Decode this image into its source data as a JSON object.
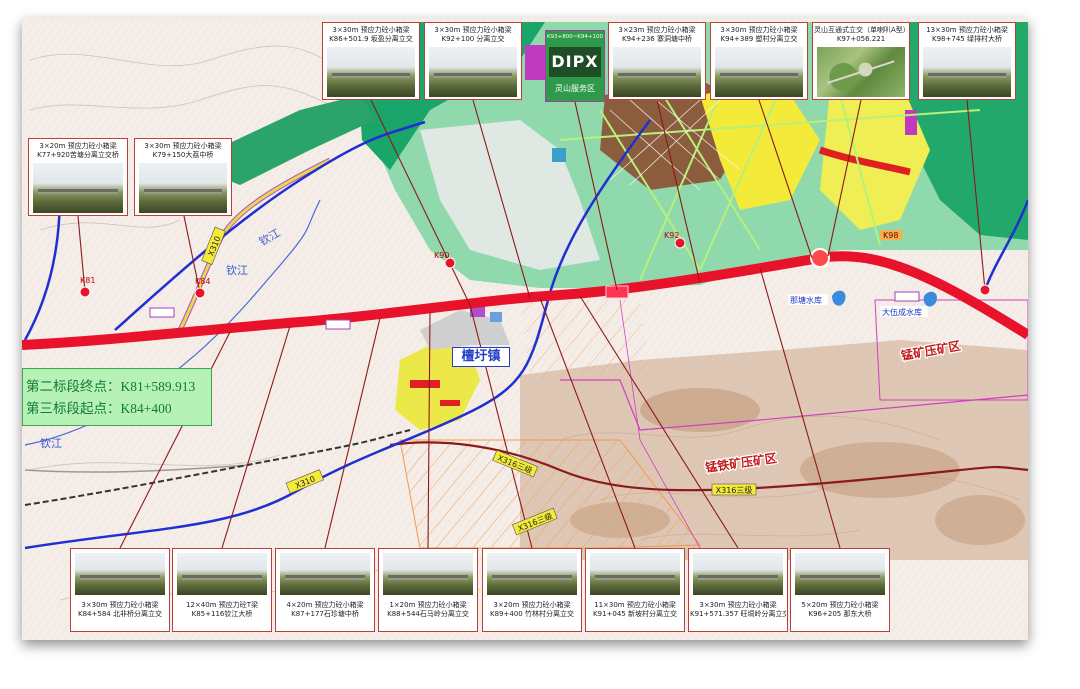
{
  "section_box": {
    "end_label": "第二标段终点：K81+589.913",
    "start_label": "第三标段起点：K84+400"
  },
  "service_area": {
    "chainage": "K93+800~K94+100",
    "icons": "DIPX",
    "name": "灵山服务区"
  },
  "callouts_top": [
    {
      "line1": "3×30m 预应力砼小箱梁",
      "line2": "K86+501.9 坂盈分离立交"
    },
    {
      "line1": "3×30m 预应力砼小箱梁",
      "line2": "K92+100 分离立交"
    },
    {
      "line1": "3×23m 预应力砼小箱梁",
      "line2": "K94+236 寨洞塘中桥"
    },
    {
      "line1": "3×30m 预应力砼小箱梁",
      "line2": "K94+389 塑村分离立交"
    },
    {
      "line1": "灵山互通式立交（单喇叭A型）",
      "line2": "K97+056.221"
    },
    {
      "line1": "13×30m 预应力砼小箱梁",
      "line2": "K98+745 绿排村大桥"
    }
  ],
  "callouts_left": [
    {
      "line1": "3×20m 预应力砼小箱梁",
      "line2": "K77+920苦塘分离立交桥"
    },
    {
      "line1": "3×30m 预应力砼小箱梁",
      "line2": "K79+150大荔中桥"
    }
  ],
  "callouts_bottom": [
    {
      "line1": "3×30m 预应力砼小箱梁",
      "line2": "K84+584 北非桥分离立交"
    },
    {
      "line1": "12×40m 预应力砼T梁",
      "line2": "K85+116钦江大桥"
    },
    {
      "line1": "4×20m 预应力砼小箱梁",
      "line2": "K87+177石珍塘中桥"
    },
    {
      "line1": "1×20m 预应力砼小箱梁",
      "line2": "K88+544石马岭分离立交"
    },
    {
      "line1": "3×20m 预应力砼小箱梁",
      "line2": "K89+400 竹林村分离立交"
    },
    {
      "line1": "11×30m 预应力砼小箱梁",
      "line2": "K91+045 新坡村分离立交"
    },
    {
      "line1": "3×30m 预应力砼小箱梁",
      "line2": "K91+571.357 旺垌岭分离立交"
    },
    {
      "line1": "5×20m 预应力砼小箱梁",
      "line2": "K96+205 那东大桥"
    }
  ],
  "map": {
    "town": "檀圩镇",
    "rivers": [
      "钦江",
      "钦江",
      "钦江"
    ],
    "mining_areas": [
      "锰铁矿压矿区",
      "锰矿压矿区"
    ],
    "reservoirs": [
      "那塘水库",
      "大伍成水库"
    ],
    "road_tags": [
      "X310",
      "X310",
      "X316三级",
      "X316三级",
      "X316三级"
    ],
    "chainage_markers": [
      "K81",
      "K84",
      "K90",
      "K92",
      "K98"
    ],
    "colors": {
      "route": "#e8132a",
      "river": "#1f2fd0",
      "green_zone": "#8fd9ad",
      "section_box": "#b6f2b6",
      "town_label": "#2240c8"
    }
  }
}
